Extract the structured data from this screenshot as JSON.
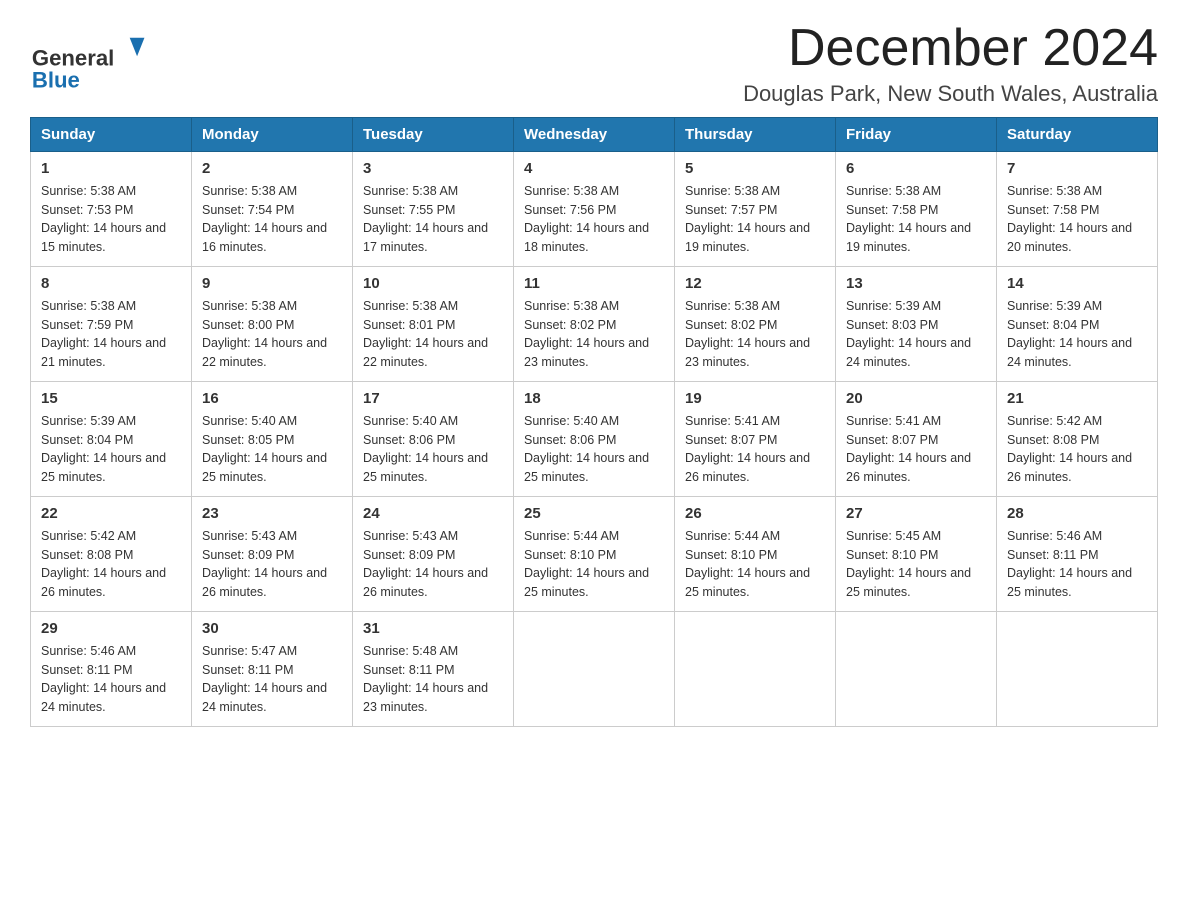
{
  "logo": {
    "general": "General",
    "blue": "Blue"
  },
  "header": {
    "month_year": "December 2024",
    "location": "Douglas Park, New South Wales, Australia"
  },
  "weekdays": [
    "Sunday",
    "Monday",
    "Tuesday",
    "Wednesday",
    "Thursday",
    "Friday",
    "Saturday"
  ],
  "weeks": [
    [
      {
        "day": "1",
        "sunrise": "5:38 AM",
        "sunset": "7:53 PM",
        "daylight": "14 hours and 15 minutes."
      },
      {
        "day": "2",
        "sunrise": "5:38 AM",
        "sunset": "7:54 PM",
        "daylight": "14 hours and 16 minutes."
      },
      {
        "day": "3",
        "sunrise": "5:38 AM",
        "sunset": "7:55 PM",
        "daylight": "14 hours and 17 minutes."
      },
      {
        "day": "4",
        "sunrise": "5:38 AM",
        "sunset": "7:56 PM",
        "daylight": "14 hours and 18 minutes."
      },
      {
        "day": "5",
        "sunrise": "5:38 AM",
        "sunset": "7:57 PM",
        "daylight": "14 hours and 19 minutes."
      },
      {
        "day": "6",
        "sunrise": "5:38 AM",
        "sunset": "7:58 PM",
        "daylight": "14 hours and 19 minutes."
      },
      {
        "day": "7",
        "sunrise": "5:38 AM",
        "sunset": "7:58 PM",
        "daylight": "14 hours and 20 minutes."
      }
    ],
    [
      {
        "day": "8",
        "sunrise": "5:38 AM",
        "sunset": "7:59 PM",
        "daylight": "14 hours and 21 minutes."
      },
      {
        "day": "9",
        "sunrise": "5:38 AM",
        "sunset": "8:00 PM",
        "daylight": "14 hours and 22 minutes."
      },
      {
        "day": "10",
        "sunrise": "5:38 AM",
        "sunset": "8:01 PM",
        "daylight": "14 hours and 22 minutes."
      },
      {
        "day": "11",
        "sunrise": "5:38 AM",
        "sunset": "8:02 PM",
        "daylight": "14 hours and 23 minutes."
      },
      {
        "day": "12",
        "sunrise": "5:38 AM",
        "sunset": "8:02 PM",
        "daylight": "14 hours and 23 minutes."
      },
      {
        "day": "13",
        "sunrise": "5:39 AM",
        "sunset": "8:03 PM",
        "daylight": "14 hours and 24 minutes."
      },
      {
        "day": "14",
        "sunrise": "5:39 AM",
        "sunset": "8:04 PM",
        "daylight": "14 hours and 24 minutes."
      }
    ],
    [
      {
        "day": "15",
        "sunrise": "5:39 AM",
        "sunset": "8:04 PM",
        "daylight": "14 hours and 25 minutes."
      },
      {
        "day": "16",
        "sunrise": "5:40 AM",
        "sunset": "8:05 PM",
        "daylight": "14 hours and 25 minutes."
      },
      {
        "day": "17",
        "sunrise": "5:40 AM",
        "sunset": "8:06 PM",
        "daylight": "14 hours and 25 minutes."
      },
      {
        "day": "18",
        "sunrise": "5:40 AM",
        "sunset": "8:06 PM",
        "daylight": "14 hours and 25 minutes."
      },
      {
        "day": "19",
        "sunrise": "5:41 AM",
        "sunset": "8:07 PM",
        "daylight": "14 hours and 26 minutes."
      },
      {
        "day": "20",
        "sunrise": "5:41 AM",
        "sunset": "8:07 PM",
        "daylight": "14 hours and 26 minutes."
      },
      {
        "day": "21",
        "sunrise": "5:42 AM",
        "sunset": "8:08 PM",
        "daylight": "14 hours and 26 minutes."
      }
    ],
    [
      {
        "day": "22",
        "sunrise": "5:42 AM",
        "sunset": "8:08 PM",
        "daylight": "14 hours and 26 minutes."
      },
      {
        "day": "23",
        "sunrise": "5:43 AM",
        "sunset": "8:09 PM",
        "daylight": "14 hours and 26 minutes."
      },
      {
        "day": "24",
        "sunrise": "5:43 AM",
        "sunset": "8:09 PM",
        "daylight": "14 hours and 26 minutes."
      },
      {
        "day": "25",
        "sunrise": "5:44 AM",
        "sunset": "8:10 PM",
        "daylight": "14 hours and 25 minutes."
      },
      {
        "day": "26",
        "sunrise": "5:44 AM",
        "sunset": "8:10 PM",
        "daylight": "14 hours and 25 minutes."
      },
      {
        "day": "27",
        "sunrise": "5:45 AM",
        "sunset": "8:10 PM",
        "daylight": "14 hours and 25 minutes."
      },
      {
        "day": "28",
        "sunrise": "5:46 AM",
        "sunset": "8:11 PM",
        "daylight": "14 hours and 25 minutes."
      }
    ],
    [
      {
        "day": "29",
        "sunrise": "5:46 AM",
        "sunset": "8:11 PM",
        "daylight": "14 hours and 24 minutes."
      },
      {
        "day": "30",
        "sunrise": "5:47 AM",
        "sunset": "8:11 PM",
        "daylight": "14 hours and 24 minutes."
      },
      {
        "day": "31",
        "sunrise": "5:48 AM",
        "sunset": "8:11 PM",
        "daylight": "14 hours and 23 minutes."
      },
      null,
      null,
      null,
      null
    ]
  ],
  "labels": {
    "sunrise": "Sunrise:",
    "sunset": "Sunset:",
    "daylight": "Daylight:"
  }
}
